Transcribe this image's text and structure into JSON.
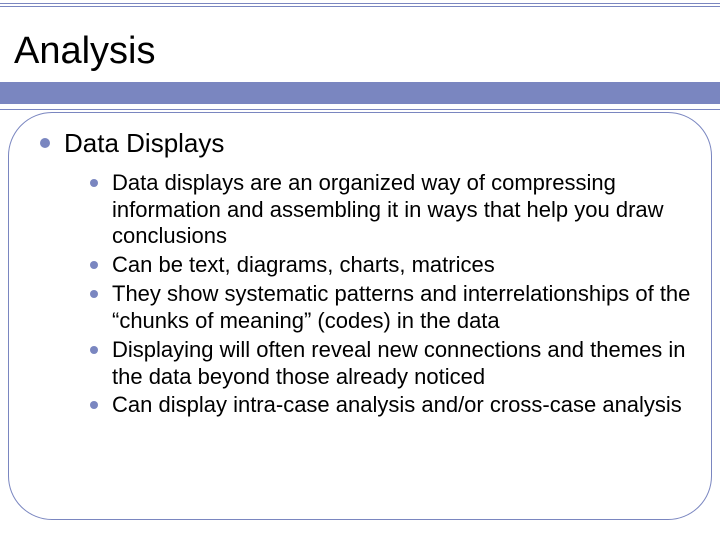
{
  "colors": {
    "accent": "#7a86c0"
  },
  "title": "Analysis",
  "body": {
    "heading": "Data Displays",
    "items": [
      "Data displays are an organized way of compressing information and assembling it in ways that help you draw conclusions",
      "Can be text, diagrams, charts, matrices",
      "They show systematic patterns and interrelationships of the “chunks of meaning” (codes) in the data",
      "Displaying will often reveal new connections and themes in the data beyond those already noticed",
      "Can display intra-case analysis and/or cross-case analysis"
    ]
  }
}
